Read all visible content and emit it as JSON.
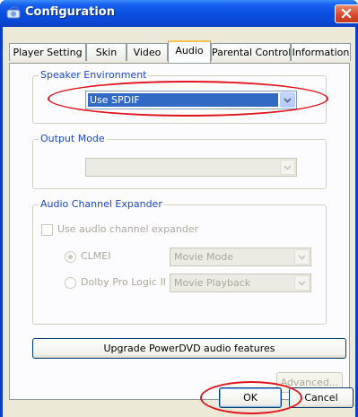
{
  "window": {
    "title": "Configuration",
    "close_icon": "close-icon"
  },
  "tabs": [
    {
      "label": "Player Setting"
    },
    {
      "label": "Skin"
    },
    {
      "label": "Video"
    },
    {
      "label": "Audio",
      "active": true
    },
    {
      "label": "Parental Control"
    },
    {
      "label": "Information"
    }
  ],
  "speaker_environment": {
    "label": "Speaker Environment",
    "selected": "Use SPDIF"
  },
  "output_mode": {
    "label": "Output Mode",
    "selected": ""
  },
  "audio_channel_expander": {
    "label": "Audio Channel Expander",
    "checkbox_label": "Use audio channel expander",
    "clmei_label": "CLMEI",
    "clmei_mode": "Movie Mode",
    "dolby_label": "Dolby Pro Logic II",
    "dolby_mode": "Movie Playback"
  },
  "buttons": {
    "upgrade": "Upgrade PowerDVD audio features",
    "advanced": "Advanced...",
    "ok": "OK",
    "cancel": "Cancel"
  },
  "colors": {
    "annotation_red": "#e0141c",
    "selection_blue": "#316ac5",
    "group_label_blue": "#1a46d1"
  }
}
